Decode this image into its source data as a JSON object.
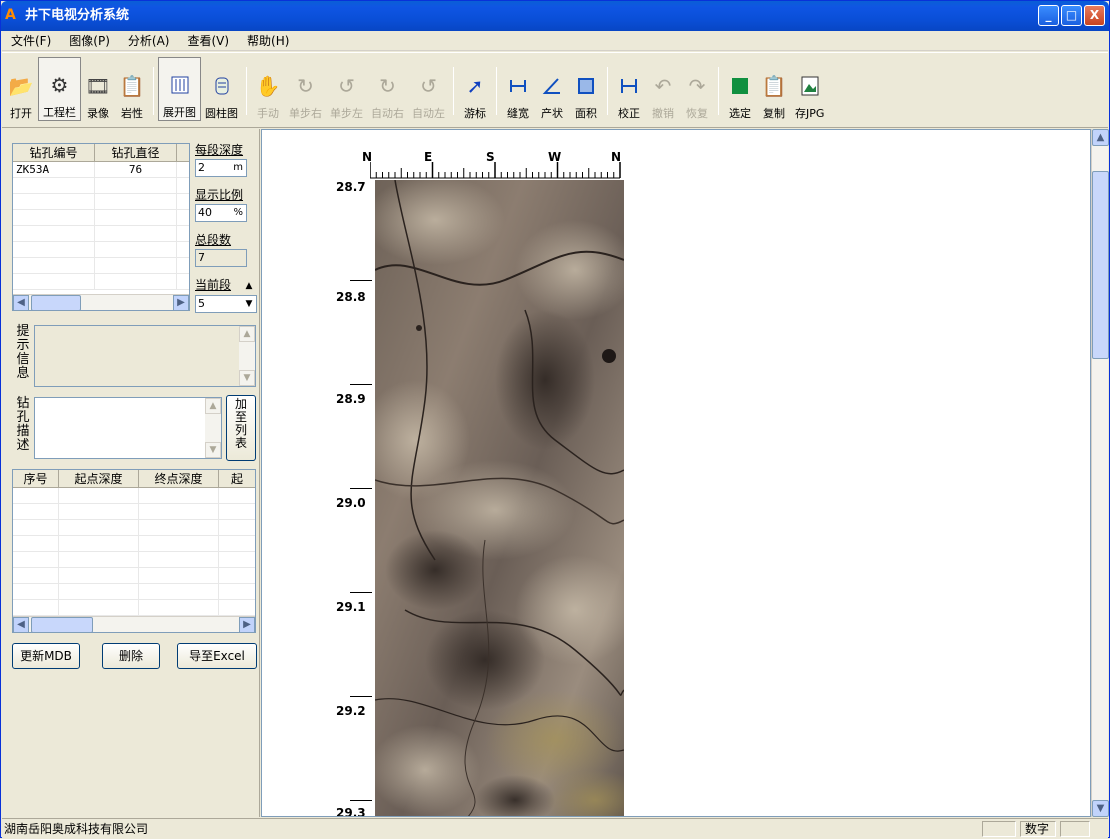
{
  "window": {
    "title": "井下电视分析系统",
    "app_icon": "A",
    "buttons": [
      "_",
      "□",
      "X"
    ]
  },
  "menu": [
    "文件(F)",
    "图像(P)",
    "分析(A)",
    "查看(V)",
    "帮助(H)"
  ],
  "toolbar": {
    "open": "打开",
    "toolbar": "工程栏",
    "record": "录像",
    "lithology": "岩性",
    "unfold": "展开图",
    "cylinder": "圆柱图",
    "manual": "手动",
    "step_right": "单步右",
    "step_left": "单步左",
    "auto_right": "自动右",
    "auto_left": "自动左",
    "cursor": "游标",
    "gap_width": "缝宽",
    "attitude": "产状",
    "area": "面积",
    "calibrate": "校正",
    "undo": "撤销",
    "redo": "恢复",
    "select": "选定",
    "copy": "复制",
    "save_jpg": "存JPG"
  },
  "borehole_grid": {
    "headers": [
      "钻孔编号",
      "钻孔直径"
    ],
    "rows": [
      [
        "ZK53A",
        "76"
      ]
    ]
  },
  "settings": {
    "segment_depth_label": "每段深度",
    "segment_depth_value": "2",
    "segment_depth_unit": "m",
    "display_ratio_label": "显示比例",
    "display_ratio_value": "40",
    "display_ratio_unit": "%",
    "total_segments_label": "总段数",
    "total_segments_value": "7",
    "current_segment_label": "当前段",
    "current_segment_value": "5"
  },
  "hint_label": "提示信息",
  "desc_label": "钻孔描述",
  "add_to_list": "加至列表",
  "result_grid": {
    "headers": [
      "序号",
      "起点深度",
      "终点深度",
      "起"
    ]
  },
  "buttons": {
    "update_mdb": "更新MDB",
    "delete": "删除",
    "export_excel": "导至Excel"
  },
  "view": {
    "compass": [
      "N",
      "E",
      "S",
      "W",
      "N"
    ],
    "depths": [
      "28.7",
      "28.8",
      "28.9",
      "29.0",
      "29.1",
      "29.2",
      "29.3"
    ]
  },
  "status": {
    "company": "湖南岳阳奥成科技有限公司",
    "numlock": "数字"
  },
  "colors": {
    "title": "#0a4fd8",
    "rock_base": "#7d6f64",
    "rock_light": "#b4a898",
    "rock_dark": "#3e3530"
  }
}
